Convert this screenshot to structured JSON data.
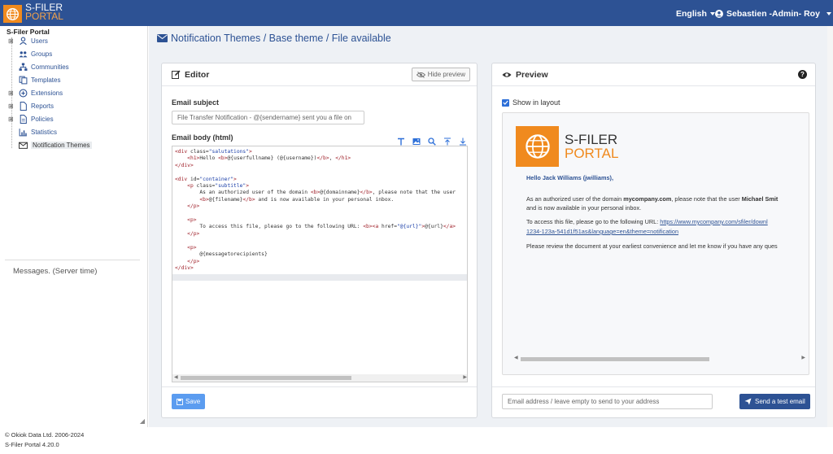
{
  "topbar": {
    "logo_line1": "S-FILER",
    "logo_line2": "PORTAL",
    "language": "English",
    "user": "Sebastien -Admin- Roy",
    "brand_color": "#2d5294",
    "accent_color": "#f08a1e"
  },
  "sidebar": {
    "title": "S-Filer Portal",
    "items": [
      {
        "label": "Users",
        "icon": "user-icon",
        "expandable": true
      },
      {
        "label": "Groups",
        "icon": "users-icon",
        "expandable": false
      },
      {
        "label": "Communities",
        "icon": "sitemap-icon",
        "expandable": false
      },
      {
        "label": "Templates",
        "icon": "copy-icon",
        "expandable": false
      },
      {
        "label": "Extensions",
        "icon": "plus-circle-icon",
        "expandable": true
      },
      {
        "label": "Reports",
        "icon": "file-icon",
        "expandable": true
      },
      {
        "label": "Policies",
        "icon": "file-alt-icon",
        "expandable": true
      },
      {
        "label": "Statistics",
        "icon": "chart-icon",
        "expandable": false
      },
      {
        "label": "Notification Themes",
        "icon": "envelope-icon",
        "expandable": false,
        "selected": true
      }
    ],
    "messages_title": "Messages. (Server time)"
  },
  "page": {
    "title": "Notification Themes / Base theme / File available"
  },
  "editor": {
    "title": "Editor",
    "hide_preview": "Hide preview",
    "subject_label": "Email subject",
    "subject_value": "File Transfer Notification - @{sendername} sent you a file on",
    "body_label": "Email body (html)",
    "code_lines": [
      "<div class=\"salutations\">",
      "    <h1>Hello <b>@{userfullname} (@{username})</b>, </h1>",
      "</div>",
      "",
      "<div id=\"container\">",
      "    <p class=\"subtitle\">",
      "        As an authorized user of the domain <b>@{domainname}</b>, please note that the user",
      "        <b>@{filename}</b> and is now available in your personal inbox.",
      "    </p>",
      "",
      "    <p>",
      "        To access this file, please go to the following URL: <b><a href=\"@{url}\">@{url}</a>",
      "    </p>",
      "",
      "    <p>",
      "        @{messagetorecipients}",
      "    </p>",
      "</div>",
      ""
    ],
    "save_label": "Save"
  },
  "preview": {
    "title": "Preview",
    "help": "?",
    "show_in_layout": "Show in layout",
    "logo_line1": "S-FILER",
    "logo_line2": "PORTAL",
    "greeting": "Hello Jack Williams (jwilliams),",
    "para1_a": "As an authorized user of the domain ",
    "para1_domain": "mycompany.com",
    "para1_b": ", please note that the user ",
    "para1_user": "Michael Smit",
    "para1_line2": "and is now available in your personal inbox.",
    "para2_a": "To access this file, please go to the following URL: ",
    "para2_link1": "https://www.mycompany.com/sfiler/downl",
    "para2_link2": "1234-123a-541d1f51as&language=en&theme=notification",
    "para3": "Please review the document at your earliest convenience and let me know if you have any ques",
    "email_placeholder": "Email address / leave empty to send to your address",
    "send_label": "Send a test email"
  },
  "footer": {
    "copyright": "© Okiok Data Ltd. 2006-2024",
    "version": "S-Filer Portal 4.20.0"
  }
}
